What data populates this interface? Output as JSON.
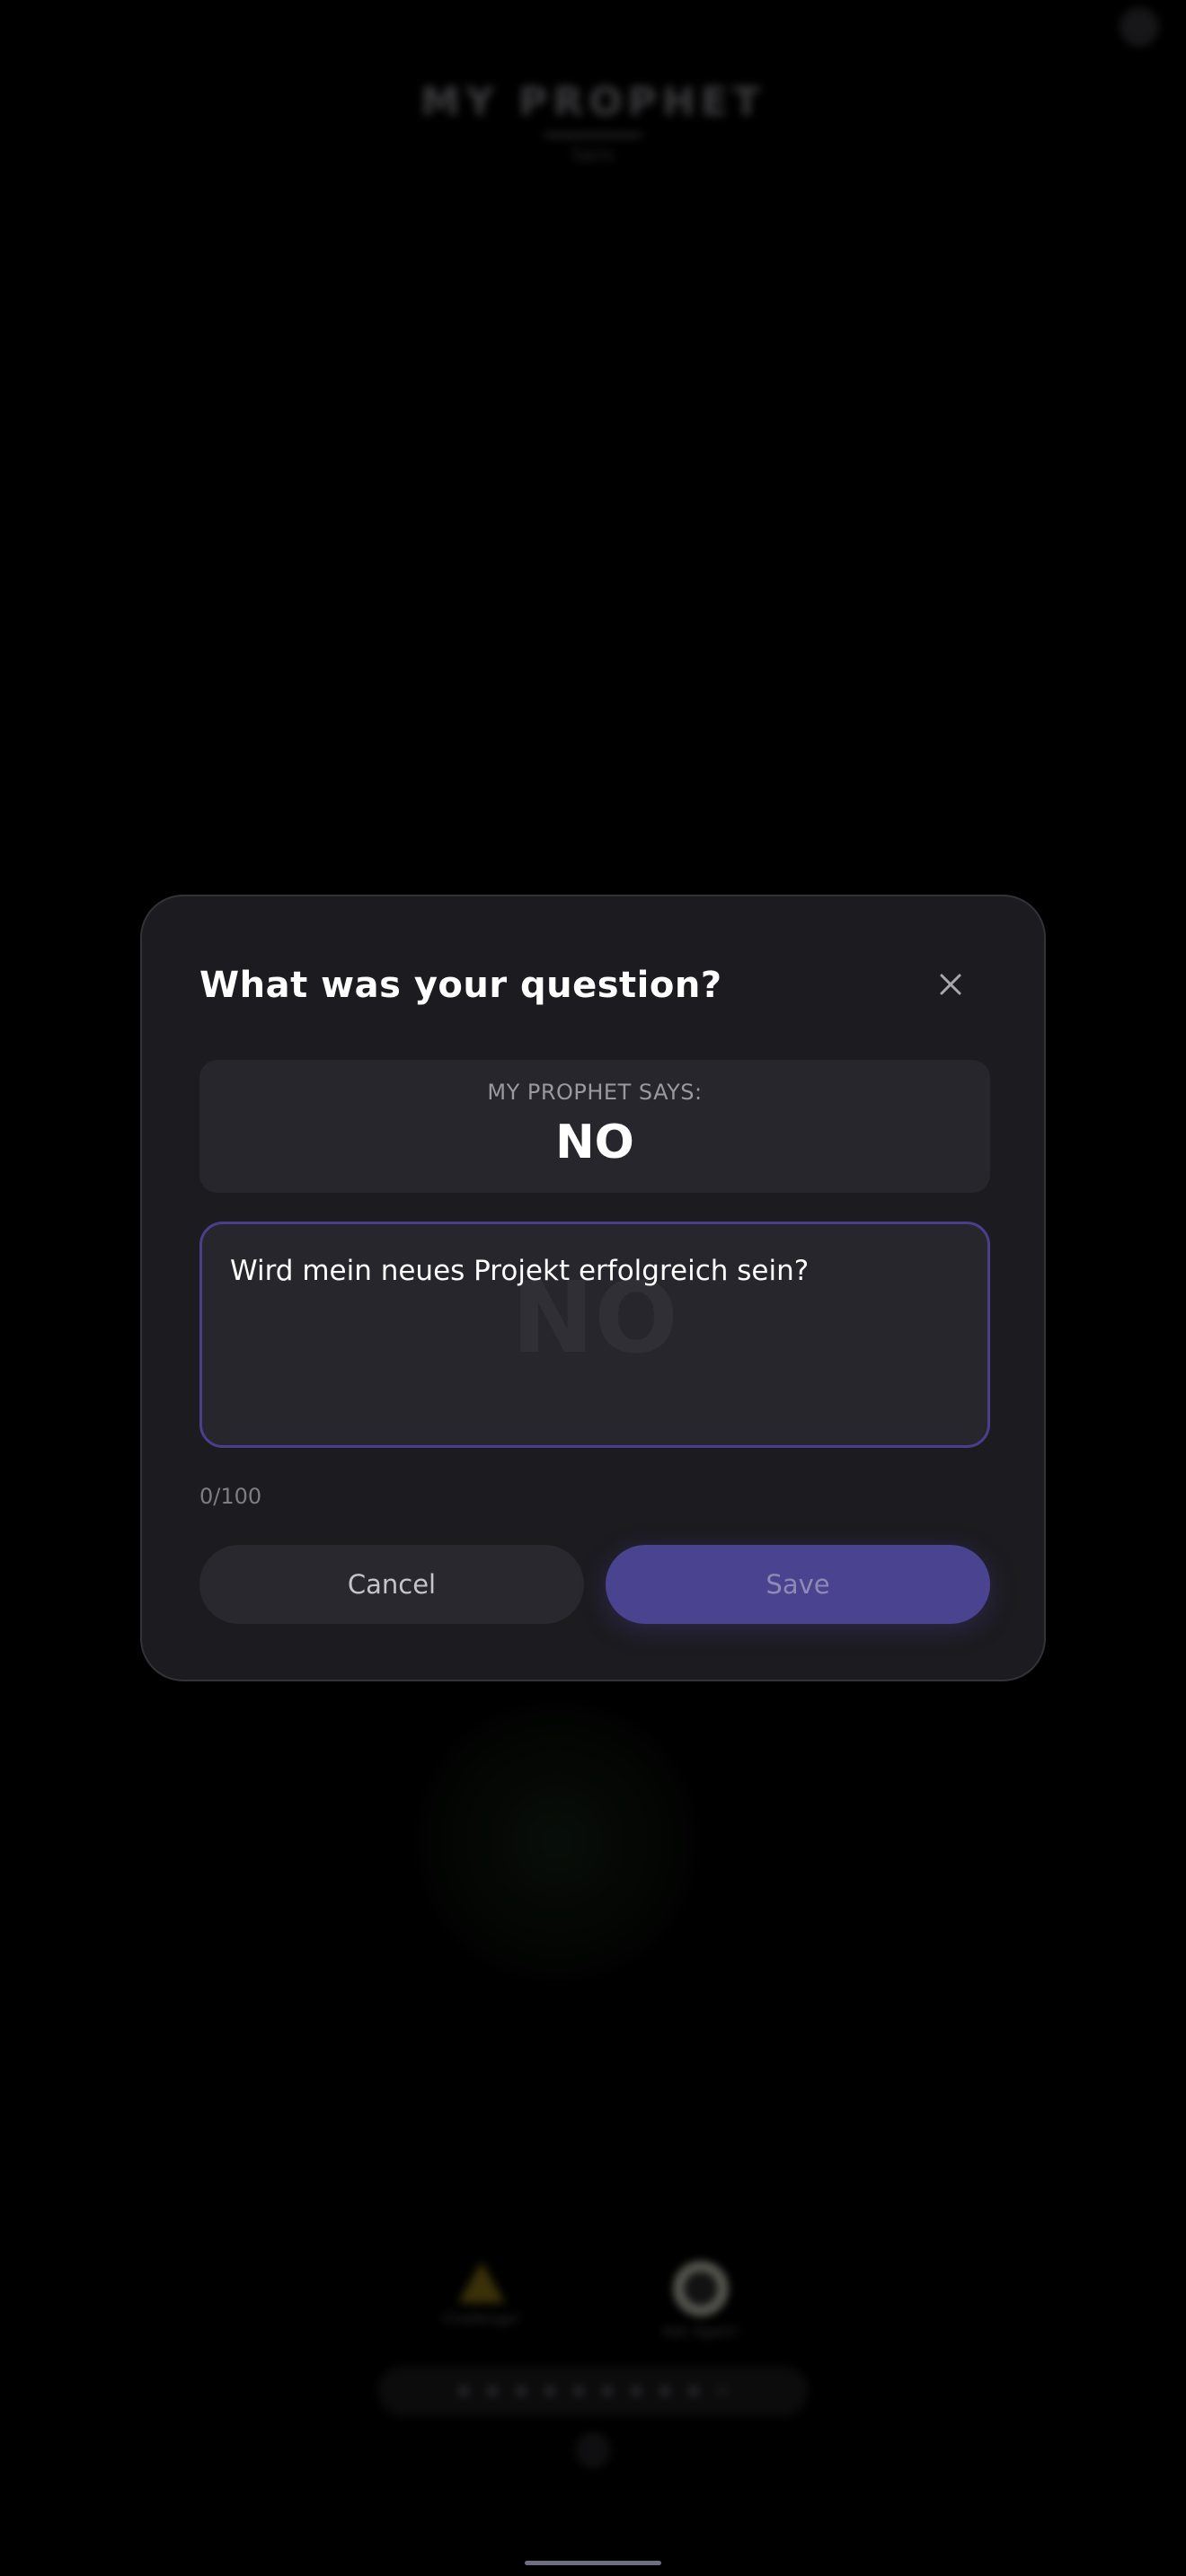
{
  "background": {
    "app_title": "MY PROPHET",
    "subtitle": "Sans",
    "actions": [
      {
        "label": "Challenge!",
        "icon": "warning-triangle-icon"
      },
      {
        "label": "Ask Again!",
        "icon": "ring-icon"
      }
    ]
  },
  "modal": {
    "title": "What was your question?",
    "close_icon": "close-icon",
    "answer_label": "MY PROPHET SAYS:",
    "answer_value": "NO",
    "question_watermark": "NO",
    "question_text": "Wird mein neues Projekt erfolgreich sein?",
    "char_count": "0/100",
    "cancel_label": "Cancel",
    "save_label": "Save"
  },
  "colors": {
    "accent": "#4a4390",
    "input_border": "#4a3f8c",
    "modal_bg": "#1c1b20"
  }
}
